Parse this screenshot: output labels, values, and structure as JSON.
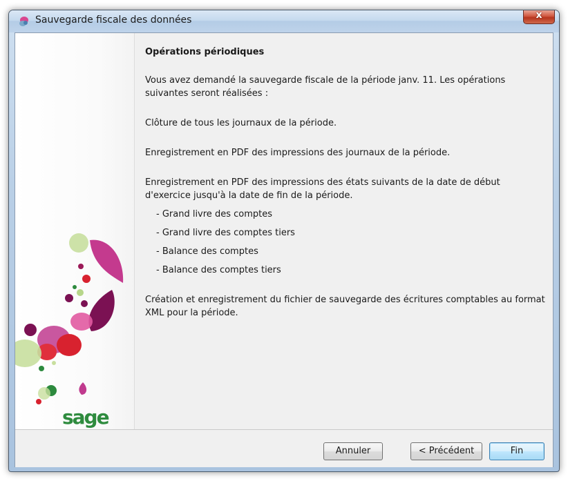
{
  "window": {
    "title": "Sauvegarde fiscale des données",
    "close_label": "x"
  },
  "side_panel": {
    "logo_text": "sage",
    "colors": {
      "magenta": "#c03a8e",
      "pink": "#e15aa1",
      "plum": "#7b1153",
      "red": "#d8222f",
      "green": "#2d8a3e",
      "light_green": "#b7d68a"
    }
  },
  "content": {
    "heading": "Opérations périodiques",
    "intro": "Vous avez demandé la sauvegarde fiscale de la période janv. 11. Les opérations suivantes seront réalisées :",
    "op1": "Clôture de tous les journaux de la période.",
    "op2": "Enregistrement en PDF des impressions des journaux de la période.",
    "op3": "Enregistrement en PDF des impressions des états suivants de la date de début d'exercice jusqu'à la date de fin de la période.",
    "list_items": [
      "- Grand livre des comptes",
      "- Grand livre des comptes tiers",
      "- Balance des comptes",
      "- Balance des comptes tiers"
    ],
    "op4": "Création et enregistrement du fichier de sauvegarde des écritures comptables au format XML pour la période."
  },
  "buttons": {
    "cancel": "Annuler",
    "previous": "< Précédent",
    "finish": "Fin"
  }
}
